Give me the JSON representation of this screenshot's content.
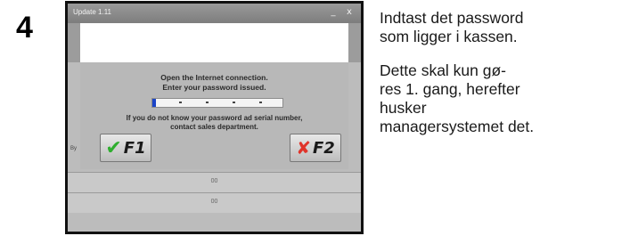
{
  "step_number": "4",
  "screenshot": {
    "window_title": "Update 1.11",
    "controls": {
      "minimize": "_",
      "close": "x"
    },
    "instructions": "Open the Internet connection.\nEnter your password issued.",
    "password_field": {
      "value": ""
    },
    "help_text": "If you do not know your password ad serial number,\ncontact sales department.",
    "buttons": {
      "confirm_label": "F1",
      "cancel_label": "F2"
    },
    "side_text": "By",
    "status_bar_1": "00",
    "status_bar_2": "00",
    "colors": {
      "confirm_icon": "#2fae2f",
      "cancel_icon": "#e0342a",
      "caret": "#1b44c7"
    }
  },
  "caption": {
    "paragraph_1": "Indtast det password\nsom ligger i kassen.",
    "paragraph_2": "Dette skal kun gø-\nres 1. gang, herefter\nhusker\nmanagersystemet det."
  }
}
